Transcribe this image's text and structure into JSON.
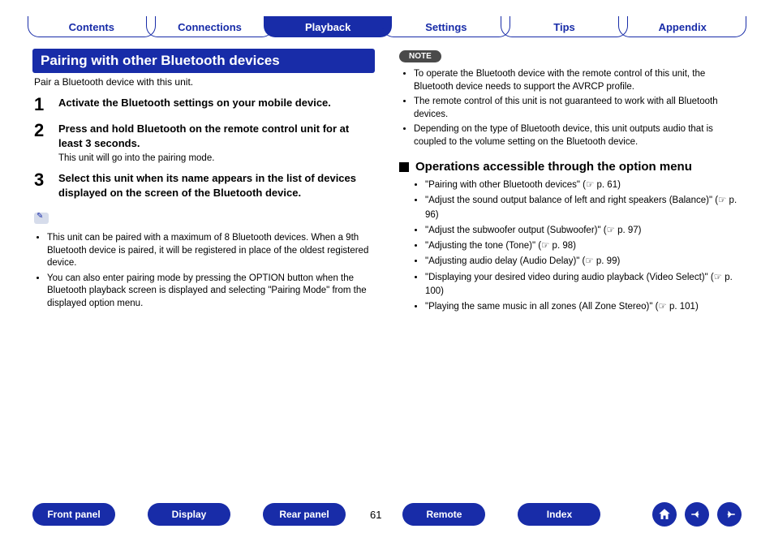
{
  "tabs": {
    "items": [
      {
        "label": "Contents",
        "active": false
      },
      {
        "label": "Connections",
        "active": false
      },
      {
        "label": "Playback",
        "active": true
      },
      {
        "label": "Settings",
        "active": false
      },
      {
        "label": "Tips",
        "active": false
      },
      {
        "label": "Appendix",
        "active": false
      }
    ]
  },
  "left": {
    "header": "Pairing with other Bluetooth devices",
    "intro": "Pair a Bluetooth device with this unit.",
    "steps": [
      {
        "num": "1",
        "title": "Activate the Bluetooth settings on your mobile device.",
        "sub": ""
      },
      {
        "num": "2",
        "title": "Press and hold Bluetooth on the remote control unit for at least 3 seconds.",
        "sub": "This unit will go into the pairing mode."
      },
      {
        "num": "3",
        "title": "Select this unit when its name appears in the list of devices displayed on the screen of the Bluetooth device.",
        "sub": ""
      }
    ],
    "tips": [
      "This unit can be paired with a maximum of 8 Bluetooth devices. When a 9th Bluetooth device is paired, it will be registered in place of the oldest registered device.",
      "You can also enter pairing mode by pressing the OPTION button when the Bluetooth playback screen is displayed and selecting \"Pairing Mode\" from the displayed option menu."
    ]
  },
  "right": {
    "note_label": "NOTE",
    "notes": [
      "To operate the Bluetooth device with the remote control of this unit, the Bluetooth device needs to support the AVRCP profile.",
      "The remote control of this unit is not guaranteed to work with all Bluetooth devices.",
      "Depending on the type of Bluetooth device, this unit outputs audio that is coupled to the volume setting on the Bluetooth device."
    ],
    "ops_heading": "Operations accessible through the option menu",
    "ops": [
      "\"Pairing with other Bluetooth devices\" (☞ p. 61)",
      "\"Adjust the sound output balance of left and right speakers (Balance)\" (☞ p. 96)",
      "\"Adjust the subwoofer output (Subwoofer)\" (☞ p. 97)",
      "\"Adjusting the tone (Tone)\" (☞ p. 98)",
      "\"Adjusting audio delay (Audio Delay)\" (☞ p. 99)",
      "\"Displaying your desired video during audio playback (Video Select)\" (☞ p. 100)",
      "\"Playing the same music in all zones (All Zone Stereo)\" (☞ p. 101)"
    ]
  },
  "footer": {
    "links": [
      "Front panel",
      "Display",
      "Rear panel",
      "Remote",
      "Index"
    ],
    "page": "61"
  }
}
